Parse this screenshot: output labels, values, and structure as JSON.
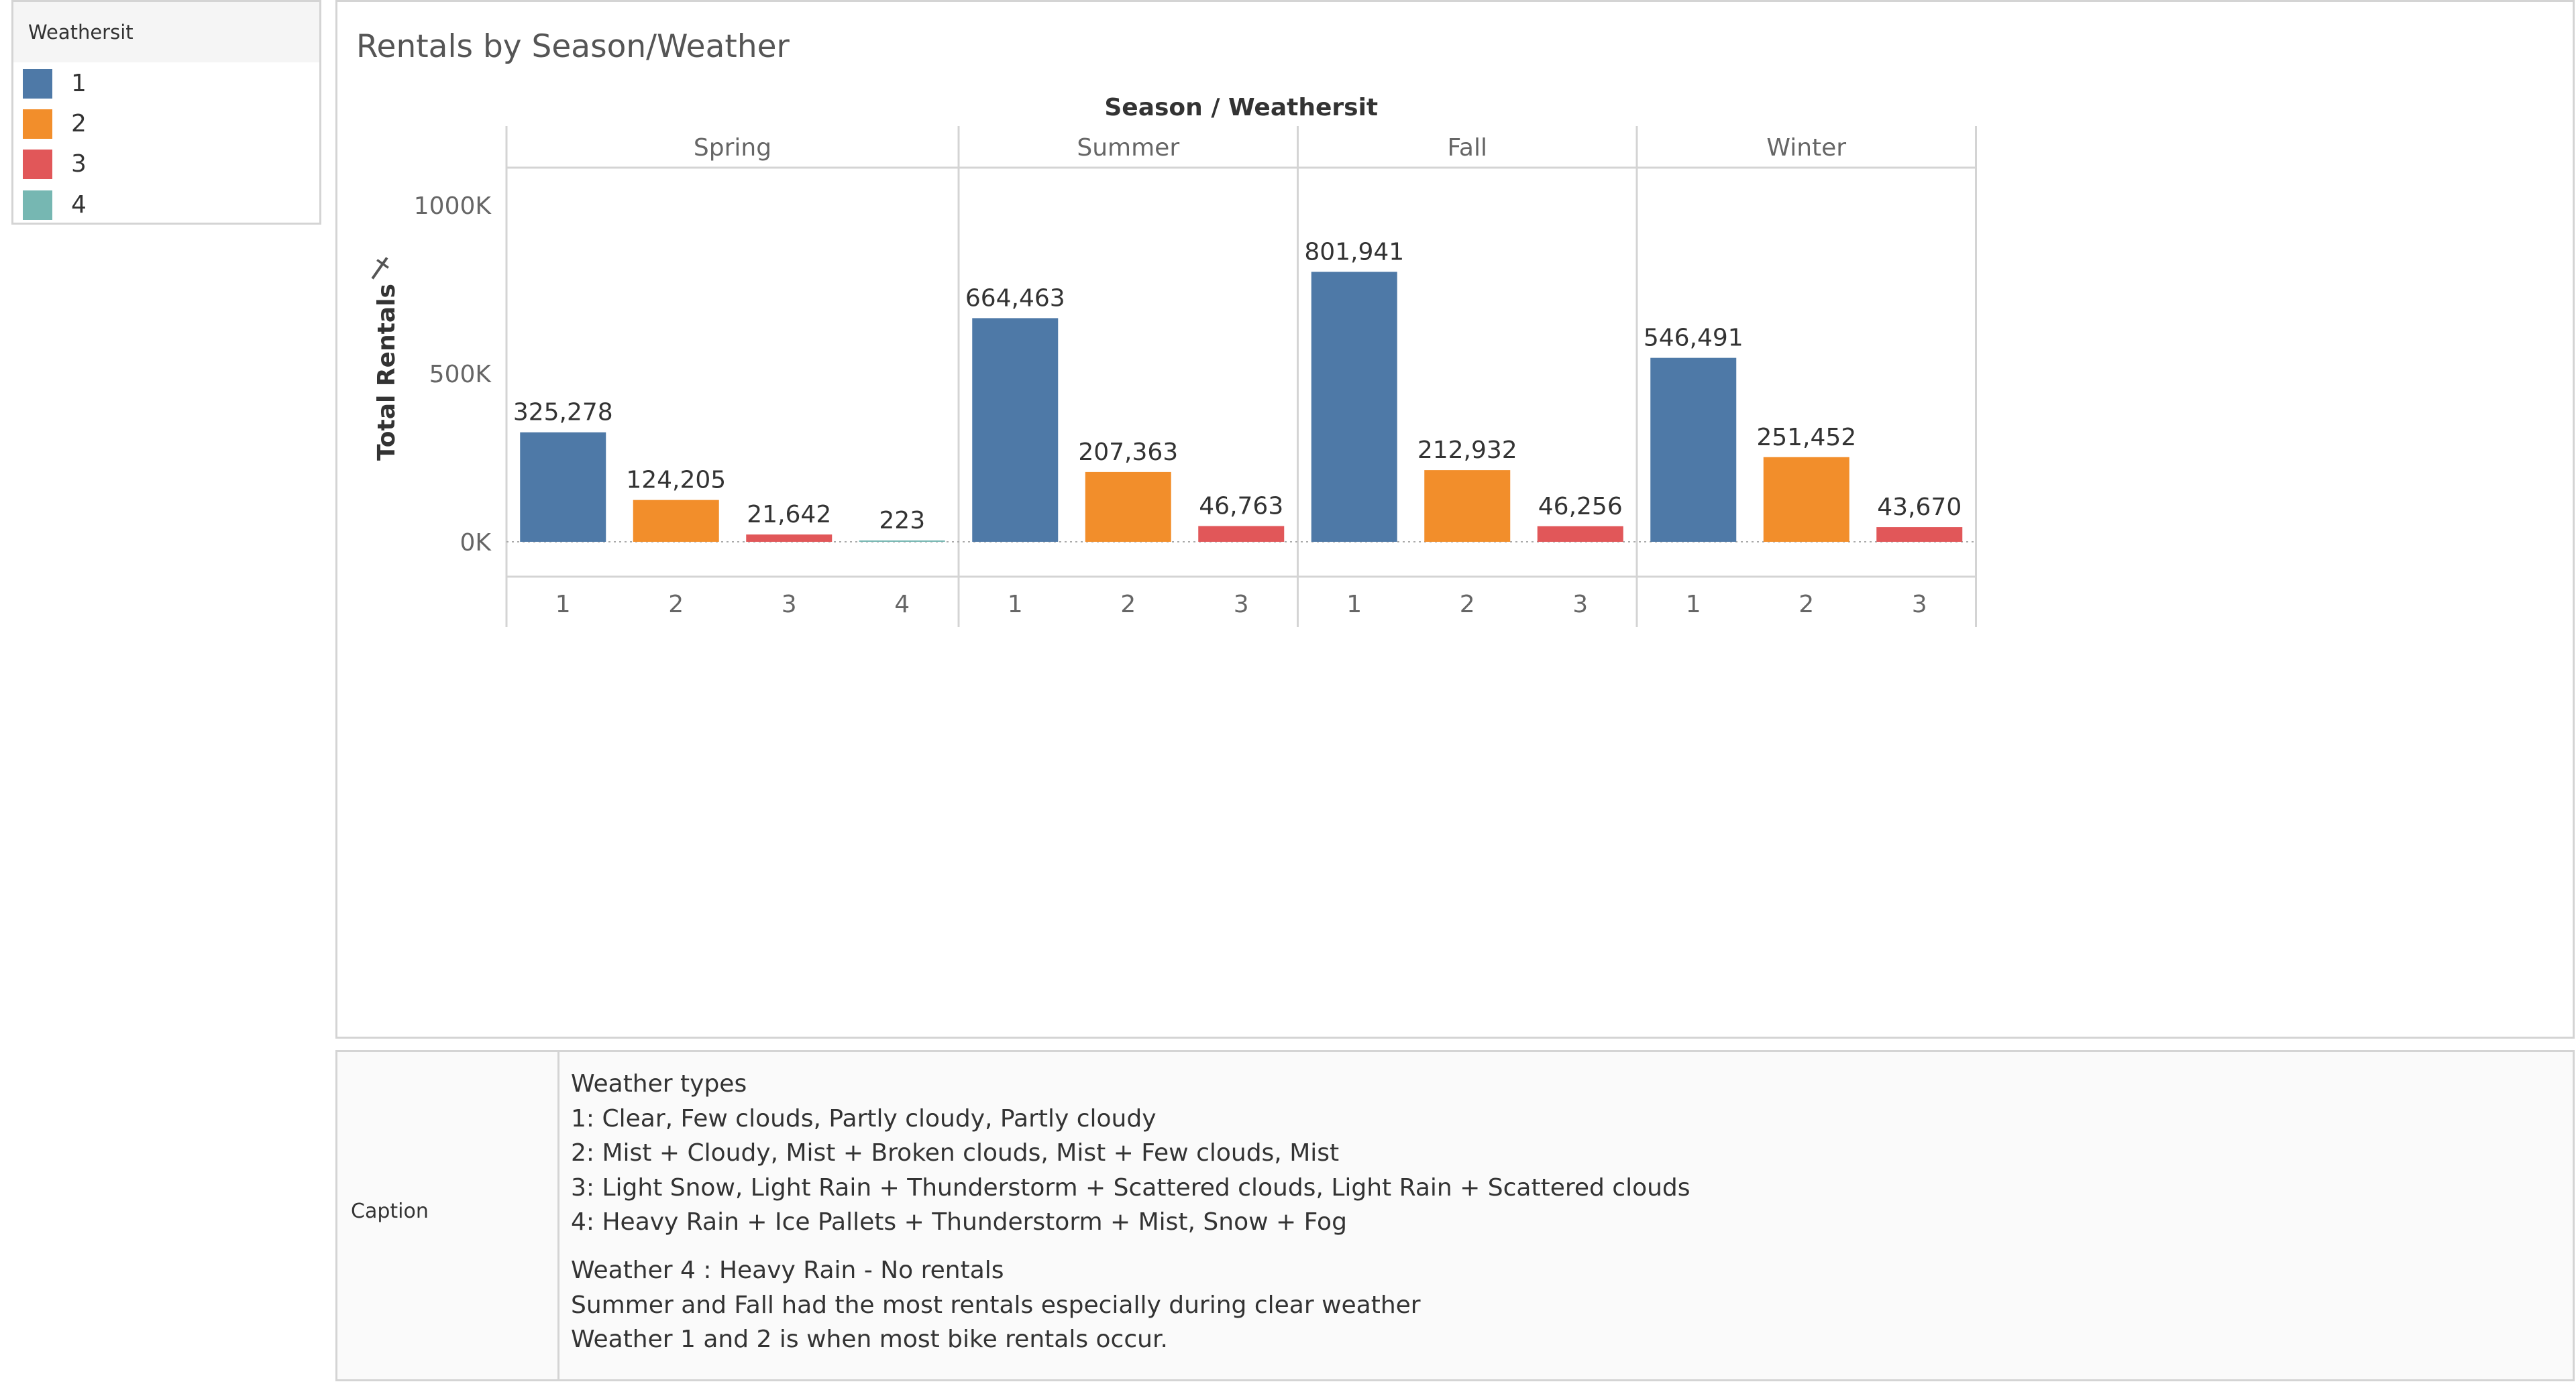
{
  "legend": {
    "title": "Weathersit",
    "items": [
      {
        "label": "1",
        "color": "#4e79a7"
      },
      {
        "label": "2",
        "color": "#f28e2b"
      },
      {
        "label": "3",
        "color": "#e15759"
      },
      {
        "label": "4",
        "color": "#76b7b2"
      }
    ]
  },
  "chart_title": "Rentals by Season/Weather",
  "chart_data": {
    "type": "bar",
    "title": "Rentals by Season/Weather",
    "header": "Season  /  Weathersit",
    "ylabel": "Total Rentals",
    "ylim": [
      0,
      1000000
    ],
    "yticks": [
      "1000K",
      "500K",
      "0K"
    ],
    "ytick_values": [
      1000000,
      500000,
      0
    ],
    "legend_position": "top-left",
    "seasons": [
      {
        "name": "Spring",
        "bars": [
          {
            "weathersit": "1",
            "value": 325278,
            "label": "325,278"
          },
          {
            "weathersit": "2",
            "value": 124205,
            "label": "124,205"
          },
          {
            "weathersit": "3",
            "value": 21642,
            "label": "21,642"
          },
          {
            "weathersit": "4",
            "value": 223,
            "label": "223"
          }
        ]
      },
      {
        "name": "Summer",
        "bars": [
          {
            "weathersit": "1",
            "value": 664463,
            "label": "664,463"
          },
          {
            "weathersit": "2",
            "value": 207363,
            "label": "207,363"
          },
          {
            "weathersit": "3",
            "value": 46763,
            "label": "46,763"
          }
        ]
      },
      {
        "name": "Fall",
        "bars": [
          {
            "weathersit": "1",
            "value": 801941,
            "label": "801,941"
          },
          {
            "weathersit": "2",
            "value": 212932,
            "label": "212,932"
          },
          {
            "weathersit": "3",
            "value": 46256,
            "label": "46,256"
          }
        ]
      },
      {
        "name": "Winter",
        "bars": [
          {
            "weathersit": "1",
            "value": 546491,
            "label": "546,491"
          },
          {
            "weathersit": "2",
            "value": 251452,
            "label": "251,452"
          },
          {
            "weathersit": "3",
            "value": 43670,
            "label": "43,670"
          }
        ]
      }
    ]
  },
  "caption": {
    "label": "Caption",
    "lines": [
      "Weather types",
      "1: Clear, Few clouds, Partly cloudy, Partly cloudy",
      "2: Mist + Cloudy, Mist + Broken clouds, Mist + Few clouds, Mist",
      "3: Light Snow, Light Rain + Thunderstorm + Scattered clouds, Light Rain + Scattered clouds",
      "4: Heavy Rain + Ice Pallets + Thunderstorm + Mist, Snow + Fog"
    ],
    "notes": [
      "Weather 4 :  Heavy Rain - No rentals",
      "Summer and Fall had the most rentals especially during clear weather",
      "Weather 1 and 2 is when most bike rentals occur."
    ]
  }
}
